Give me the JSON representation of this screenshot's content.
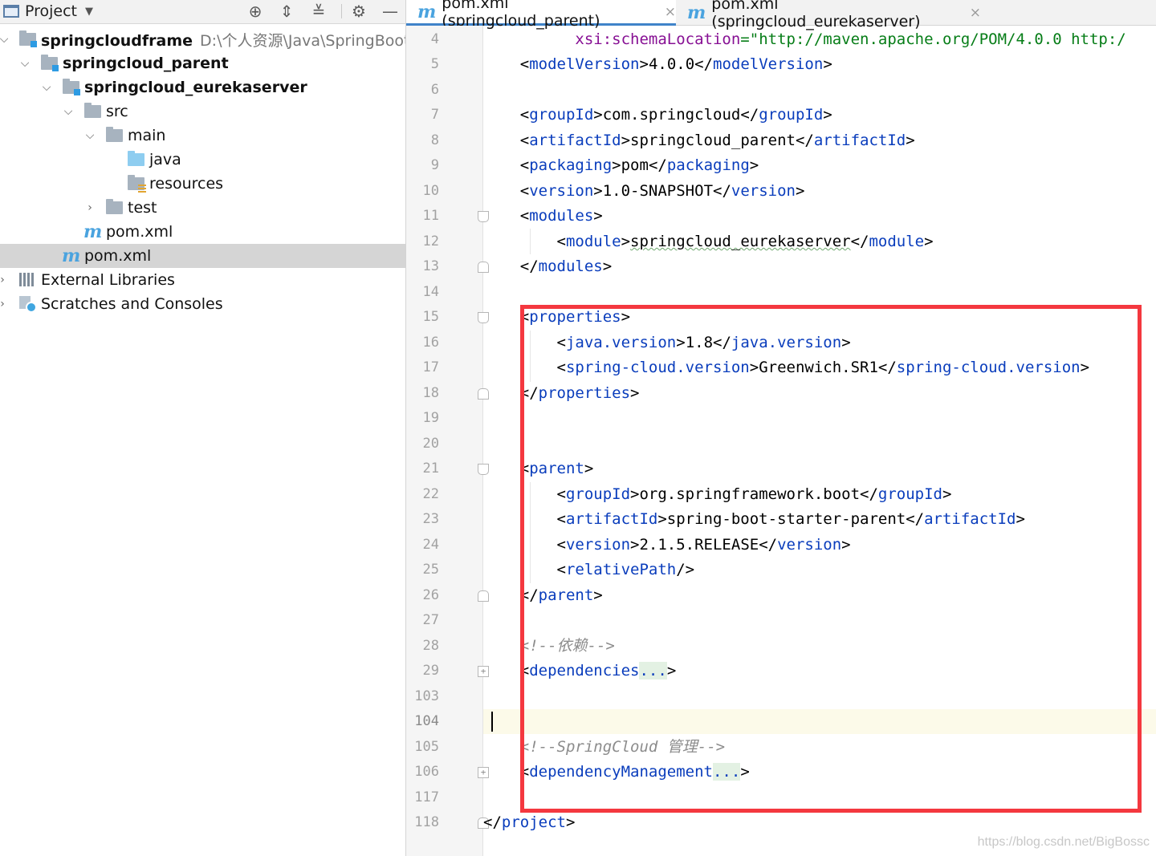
{
  "project_panel": {
    "title": "Project",
    "tree": [
      {
        "label": "springcloudframe",
        "path": "D:\\个人资源\\Java\\SpringBoot\\spri",
        "kind": "module",
        "expanded": true
      },
      {
        "label": "springcloud_parent",
        "kind": "module",
        "expanded": true
      },
      {
        "label": "springcloud_eurekaserver",
        "kind": "module",
        "expanded": true
      },
      {
        "label": "src",
        "kind": "folder",
        "expanded": true
      },
      {
        "label": "main",
        "kind": "folder",
        "expanded": true
      },
      {
        "label": "java",
        "kind": "source-folder"
      },
      {
        "label": "resources",
        "kind": "resources-folder"
      },
      {
        "label": "test",
        "kind": "folder",
        "expanded": false
      },
      {
        "label": "pom.xml",
        "kind": "maven-file"
      },
      {
        "label": "pom.xml",
        "kind": "maven-file",
        "selected": true
      },
      {
        "label": "External Libraries",
        "kind": "libraries"
      },
      {
        "label": "Scratches and Consoles",
        "kind": "scratches"
      }
    ]
  },
  "editor": {
    "tabs": [
      {
        "label": "pom.xml (springcloud_parent)",
        "active": true
      },
      {
        "label": "pom.xml (springcloud_eurekaserver)",
        "active": false
      }
    ],
    "line_numbers": [
      "4",
      "5",
      "6",
      "7",
      "8",
      "9",
      "10",
      "11",
      "12",
      "13",
      "14",
      "15",
      "16",
      "17",
      "18",
      "19",
      "20",
      "21",
      "22",
      "23",
      "24",
      "25",
      "26",
      "27",
      "28",
      "29",
      "103",
      "104",
      "105",
      "106",
      "117",
      "118"
    ],
    "current_line": "104",
    "code_text": {
      "l4_attr": "xsi:schemaLocation",
      "l4_eq": "=",
      "l4_val": "\"http://maven.apache.org/POM/4.0.0 http:/",
      "model_tag": "modelVersion",
      "model_val": "4.0.0",
      "group_tag": "groupId",
      "group_val": "com.springcloud",
      "artifact_tag": "artifactId",
      "artifact_val": "springcloud_parent",
      "packaging_tag": "packaging",
      "packaging_val": "pom",
      "version_tag": "version",
      "version_val": "1.0-SNAPSHOT",
      "modules_tag": "modules",
      "module_tag": "module",
      "module_val": "springcloud_eurekaserver",
      "properties_tag": "properties",
      "java_version_tag": "java.version",
      "java_version_val": "1.8",
      "scv_tag": "spring-cloud.version",
      "scv_val": "Greenwich.SR1",
      "parent_tag": "parent",
      "p_group_val": "org.springframework.boot",
      "p_artifact_val": "spring-boot-starter-parent",
      "p_version_val": "2.1.5.RELEASE",
      "relpath_tag": "relativePath",
      "comment_deps": "<!--依赖-->",
      "deps_tag": "dependencies",
      "folded": "...",
      "comment_sc": "<!--SpringCloud 管理-->",
      "depmgmt_tag": "dependencyManagement",
      "project_tag": "project"
    }
  },
  "watermark": "https://blog.csdn.net/BigBossc",
  "colors": {
    "tag": "#0a3dbc",
    "attribute": "#871094",
    "string": "#067d17",
    "comment": "#8c8c8c",
    "highlight_box": "#f4383f",
    "selection": "#d5d5d5",
    "maven_icon": "#4aa3df"
  },
  "icons": {
    "header": [
      "project-window-icon",
      "locate-icon",
      "expand-all-icon",
      "collapse-all-icon",
      "gear-icon",
      "minimize-icon"
    ]
  }
}
